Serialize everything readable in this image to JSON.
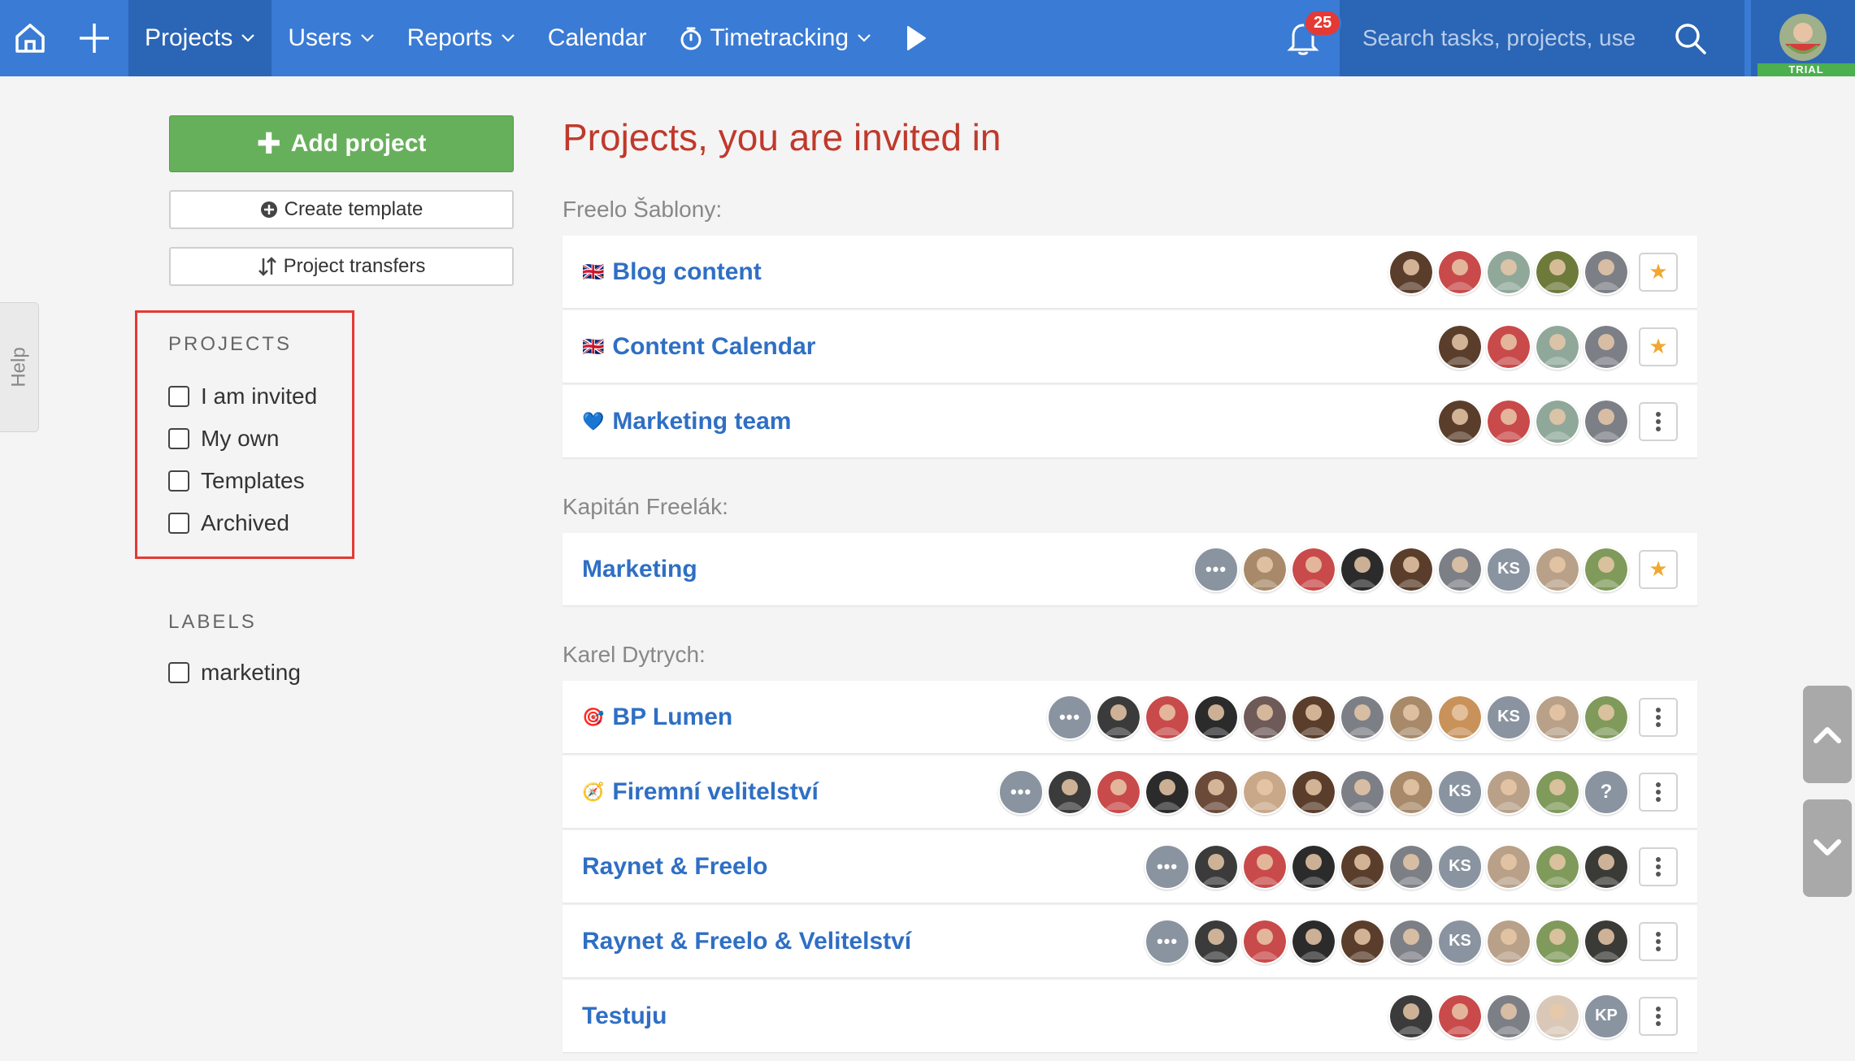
{
  "nav": {
    "items": [
      {
        "label": "Projects",
        "name": "nav-projects",
        "active": true,
        "chevron": true
      },
      {
        "label": "Users",
        "name": "nav-users",
        "chevron": true
      },
      {
        "label": "Reports",
        "name": "nav-reports",
        "chevron": true
      },
      {
        "label": "Calendar",
        "name": "nav-calendar",
        "chevron": false
      },
      {
        "label": "Timetracking",
        "name": "nav-timetracking",
        "chevron": true,
        "icon": "stopwatch-icon"
      }
    ],
    "notification_count": "25",
    "search_placeholder": "Search tasks, projects, use",
    "trial_label": "TRIAL"
  },
  "help_label": "Help",
  "sidebar": {
    "add_project": "Add project",
    "create_template": "Create template",
    "project_transfers": "Project transfers",
    "projects_heading": "PROJECTS",
    "filters": [
      "I am invited",
      "My own",
      "Templates",
      "Archived"
    ],
    "labels_heading": "LABELS",
    "labels": [
      "marketing"
    ]
  },
  "page_title": "Projects, you are invited in",
  "groups": [
    {
      "label": "Freelo Šablony:",
      "projects": [
        {
          "name": "Blog content",
          "emoji": "🇬🇧",
          "action": "star",
          "avatars": [
            "#5a3e2b",
            "#c94a4a",
            "#8fa89a",
            "#6d7a3a",
            "#7c7f86"
          ]
        },
        {
          "name": "Content Calendar",
          "emoji": "🇬🇧",
          "action": "star",
          "avatars": [
            "#5a3e2b",
            "#c94a4a",
            "#8fa89a",
            "#7c7f86"
          ]
        },
        {
          "name": "Marketing team",
          "emoji": "💙",
          "action": "menu",
          "avatars": [
            "#5a3e2b",
            "#c94a4a",
            "#8fa89a",
            "#7c7f86"
          ]
        }
      ]
    },
    {
      "label": "Kapitán Freelák:",
      "projects": [
        {
          "name": "Marketing",
          "emoji": "",
          "action": "star",
          "more": true,
          "avatars": [
            "#a88a6a",
            "#c94a4a",
            "#2b2b2b",
            "#5a3e2b",
            "#7c7f86",
            "KS",
            "#b9a088",
            "#7f9a5a"
          ]
        }
      ]
    },
    {
      "label": "Karel Dytrych:",
      "projects": [
        {
          "name": "BP Lumen",
          "emoji": "🎯",
          "action": "menu",
          "more": true,
          "avatars": [
            "#3b3b3b",
            "#c94a4a",
            "#2b2b2b",
            "#6e5a58",
            "#5a3e2b",
            "#7c7f86",
            "#a88a6a",
            "#c9925a",
            "KS",
            "#b9a088",
            "#7f9a5a"
          ]
        },
        {
          "name": "Firemní velitelství",
          "emoji": "🧭",
          "action": "menu",
          "more": true,
          "avatars": [
            "#3b3b3b",
            "#c94a4a",
            "#2b2b2b",
            "#6b4a3a",
            "#c9a88a",
            "#5a3e2b",
            "#7c7f86",
            "#a88a6a",
            "KS",
            "#b9a088",
            "#7f9a5a",
            "?"
          ]
        },
        {
          "name": "Raynet & Freelo",
          "emoji": "",
          "action": "menu",
          "more": true,
          "avatars": [
            "#3b3b3b",
            "#c94a4a",
            "#2b2b2b",
            "#5a3e2b",
            "#7c7f86",
            "KS",
            "#b9a088",
            "#7f9a5a",
            "#3a3a36"
          ]
        },
        {
          "name": "Raynet & Freelo & Velitelství",
          "emoji": "",
          "action": "menu",
          "more": true,
          "avatars": [
            "#3b3b3b",
            "#c94a4a",
            "#2b2b2b",
            "#5a3e2b",
            "#7c7f86",
            "KS",
            "#b9a088",
            "#7f9a5a",
            "#3a3a36"
          ]
        },
        {
          "name": "Testuju",
          "emoji": "",
          "action": "menu",
          "avatars": [
            "#3b3b3b",
            "#c94a4a",
            "#7c7f86",
            "#d9c8b8",
            "KP"
          ]
        }
      ]
    }
  ],
  "colors": {
    "topbar": "#3a7bd5",
    "topbar_active": "#2b65b5",
    "add_button": "#67b05b",
    "title": "#c0392b",
    "link": "#2f6fc4",
    "star": "#f0a830",
    "highlight_box": "#e53935"
  }
}
